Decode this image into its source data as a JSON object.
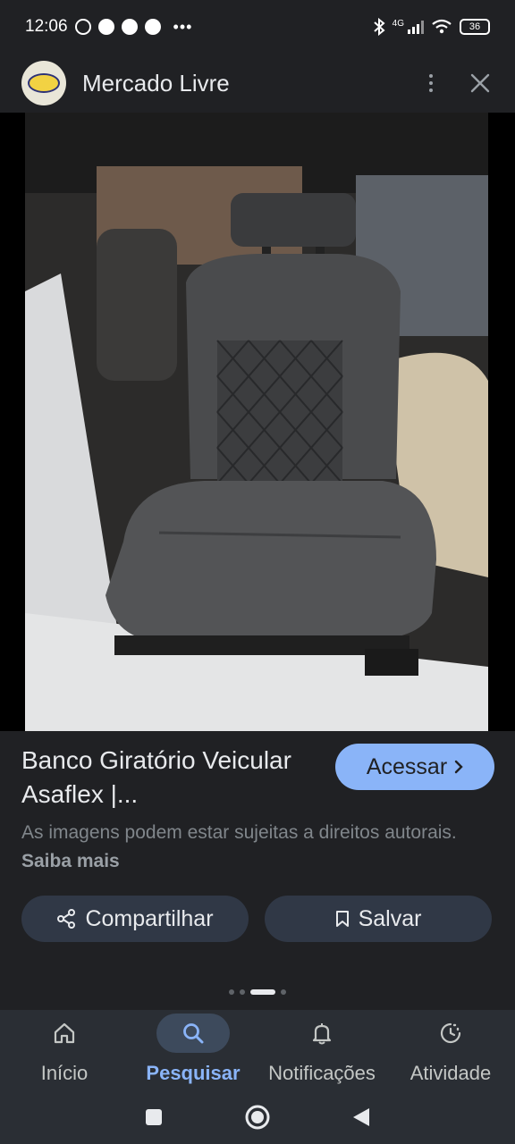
{
  "status_bar": {
    "time": "12:06",
    "network": "4G",
    "battery": "36"
  },
  "header": {
    "title": "Mercado Livre"
  },
  "product": {
    "title": "Banco Giratório Veicular Asaflex |...",
    "visit_label": "Acessar",
    "notice": "As imagens podem estar sujeitas a direitos autorais.",
    "learn_more": "Saiba mais",
    "share_label": "Compartilhar",
    "save_label": "Salvar"
  },
  "carousel": {
    "dot_count": 4,
    "active_index": 2
  },
  "bottom_nav": {
    "items": [
      {
        "label": "Início",
        "icon": "home-icon"
      },
      {
        "label": "Pesquisar",
        "icon": "search-icon",
        "active": true
      },
      {
        "label": "Notificações",
        "icon": "bell-icon"
      },
      {
        "label": "Atividade",
        "icon": "activity-icon"
      }
    ]
  },
  "colors": {
    "accent": "#8ab4f8",
    "background": "#202124",
    "button": "#303846"
  }
}
